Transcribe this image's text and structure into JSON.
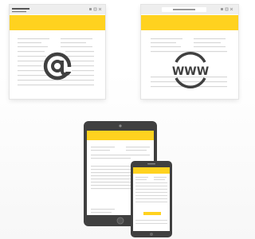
{
  "browser_windows": [
    {
      "name": "email-window",
      "symbol": "@",
      "accent": "#ffd21f"
    },
    {
      "name": "web-window",
      "symbol": "WWW",
      "accent": "#ffd21f"
    }
  ],
  "devices": {
    "tablet": {
      "accent": "#ffd21f",
      "frame": "#404040"
    },
    "phone": {
      "accent": "#ffd21f",
      "frame": "#404040"
    }
  },
  "colors": {
    "accent": "#ffd21f",
    "device_frame": "#404040",
    "text_lines": "#d8d8d8",
    "chrome": "#eeeeee"
  },
  "icons": [
    "at-sign-icon",
    "www-globe-icon",
    "tablet-icon",
    "smartphone-icon"
  ]
}
